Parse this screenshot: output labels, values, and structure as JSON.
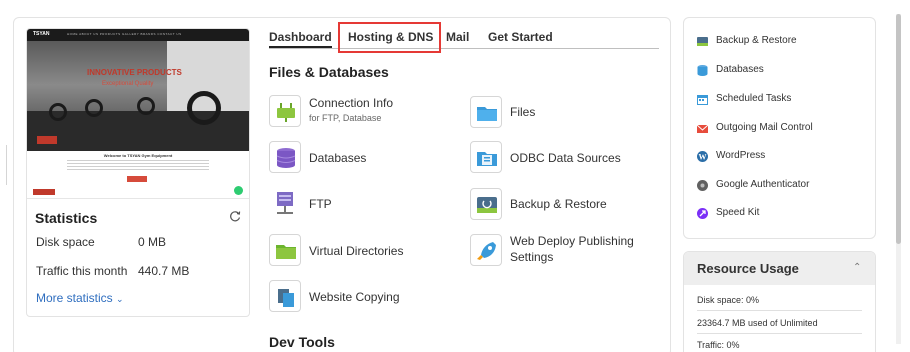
{
  "preview": {
    "logo": "TSYAN",
    "menu": "HOME  ABOUT US  PRODUCTS  GALLERY  BRANDS  CONTACT US",
    "hero_title": "INNOVATIVE PRODUCTS",
    "hero_subtitle": "Exceptional Quality",
    "welcome": "Welcome to TSYAN Gym Equipment"
  },
  "statistics": {
    "title": "Statistics",
    "rows": [
      {
        "label": "Disk space",
        "value": "0 MB"
      },
      {
        "label": "Traffic this month",
        "value": "440.7 MB"
      }
    ],
    "more_label": "More statistics"
  },
  "tabs": [
    {
      "label": "Dashboard",
      "active": true
    },
    {
      "label": "Hosting & DNS",
      "active": false
    },
    {
      "label": "Mail",
      "active": false
    },
    {
      "label": "Get Started",
      "active": false
    }
  ],
  "sections": {
    "files_title": "Files & Databases",
    "dev_title": "Dev Tools"
  },
  "tools": [
    {
      "label": "Connection Info",
      "sub": "for FTP, Database",
      "icon": "plug-icon"
    },
    {
      "label": "Files",
      "icon": "folder-icon"
    },
    {
      "label": "Databases",
      "icon": "database-icon"
    },
    {
      "label": "ODBC Data Sources",
      "icon": "odbc-icon"
    },
    {
      "label": "FTP",
      "icon": "ftp-icon"
    },
    {
      "label": "Backup & Restore",
      "icon": "backup-icon"
    },
    {
      "label": "Virtual Directories",
      "icon": "virtual-folder-icon"
    },
    {
      "label": "Web Deploy Publishing",
      "label2": "Settings",
      "icon": "rocket-icon"
    },
    {
      "label": "Website Copying",
      "icon": "copy-icon"
    }
  ],
  "quick_links": [
    {
      "label": "Backup & Restore",
      "icon": "backup-icon"
    },
    {
      "label": "Databases",
      "icon": "database-icon"
    },
    {
      "label": "Scheduled Tasks",
      "icon": "calendar-icon"
    },
    {
      "label": "Outgoing Mail Control",
      "icon": "mail-icon"
    },
    {
      "label": "WordPress",
      "icon": "wordpress-icon"
    },
    {
      "label": "Google Authenticator",
      "icon": "authenticator-icon"
    },
    {
      "label": "Speed Kit",
      "icon": "speed-kit-icon"
    }
  ],
  "resource_usage": {
    "title": "Resource Usage",
    "disk_line": "Disk space: 0%",
    "disk_detail": "23364.7 MB used of Unlimited",
    "traffic_line": "Traffic: 0%"
  },
  "colors": {
    "highlight": "#e53935",
    "link": "#2f6ebf"
  }
}
